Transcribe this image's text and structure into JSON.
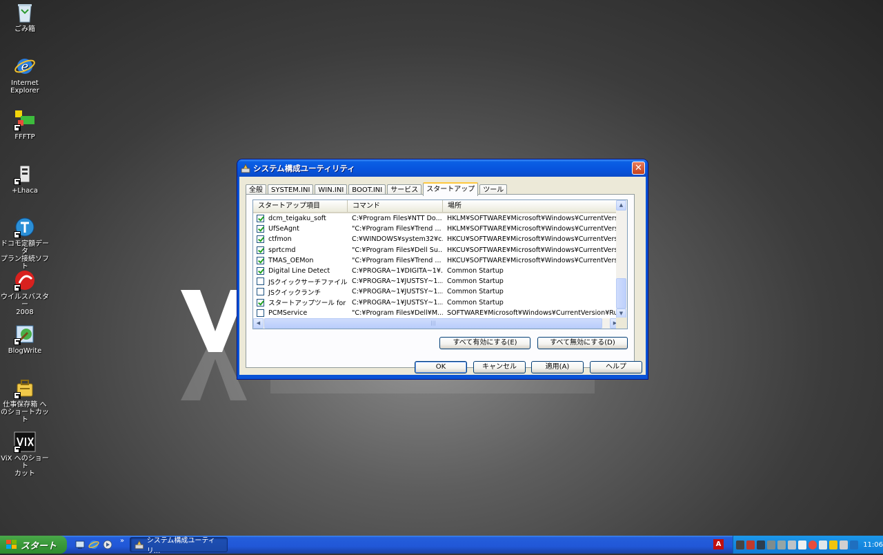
{
  "desktop": {
    "icons": [
      {
        "label": "ごみ箱"
      },
      {
        "label": "Internet\nExplorer"
      },
      {
        "label": "FFFTP"
      },
      {
        "label": "+Lhaca"
      },
      {
        "label": "ドコモ定額データ\nプラン接続ソフト"
      },
      {
        "label": "ウイルスバスター\n2008"
      },
      {
        "label": "BlogWrite"
      },
      {
        "label": "仕事保存箱 へ\nのショートカット"
      },
      {
        "label": "ViX へのショート\nカット"
      }
    ]
  },
  "window": {
    "title": "システム構成ユーティリティ",
    "close_label": "✕",
    "tabs": [
      "全般",
      "SYSTEM.INI",
      "WIN.INI",
      "BOOT.INI",
      "サービス",
      "スタートアップ",
      "ツール"
    ],
    "active_tab": "スタートアップ",
    "columns": [
      "スタートアップ項目",
      "コマンド",
      "場所"
    ],
    "rows": [
      {
        "checked": true,
        "item": "dcm_teigaku_soft",
        "command": "C:¥Program Files¥NTT Do...",
        "location": "HKLM¥SOFTWARE¥Microsoft¥Windows¥CurrentVersion¥"
      },
      {
        "checked": true,
        "item": "UfSeAgnt",
        "command": "\"C:¥Program Files¥Trend ...",
        "location": "HKLM¥SOFTWARE¥Microsoft¥Windows¥CurrentVersion¥"
      },
      {
        "checked": true,
        "item": "ctfmon",
        "command": "C:¥WINDOWS¥system32¥c...",
        "location": "HKCU¥SOFTWARE¥Microsoft¥Windows¥CurrentVersion."
      },
      {
        "checked": true,
        "item": "sprtcmd",
        "command": "\"C:¥Program Files¥Dell Su...",
        "location": "HKCU¥SOFTWARE¥Microsoft¥Windows¥CurrentVersion."
      },
      {
        "checked": true,
        "item": "TMAS_OEMon",
        "command": "\"C:¥Program Files¥Trend ...",
        "location": "HKCU¥SOFTWARE¥Microsoft¥Windows¥CurrentVersion."
      },
      {
        "checked": true,
        "item": "Digital Line Detect",
        "command": "C:¥PROGRA~1¥DIGITA~1¥...",
        "location": "Common Startup"
      },
      {
        "checked": false,
        "item": "JSクイックサーチファイル 自動...",
        "command": "C:¥PROGRA~1¥JUSTSY~1...",
        "location": "Common Startup"
      },
      {
        "checked": false,
        "item": "JSクイックランチ",
        "command": "C:¥PROGRA~1¥JUSTSY~1...",
        "location": "Common Startup"
      },
      {
        "checked": true,
        "item": "スタートアップツール for A...",
        "command": "C:¥PROGRA~1¥JUSTSY~1...",
        "location": "Common Startup"
      },
      {
        "checked": false,
        "item": "PCMService",
        "command": "\"C:¥Program Files¥Dell¥M...",
        "location": "SOFTWARE¥Microsoft¥Windows¥CurrentVersion¥Run"
      }
    ],
    "enable_all": "すべて有効にする(E)",
    "disable_all": "すべて無効にする(D)",
    "ok": "OK",
    "cancel": "キャンセル",
    "apply": "適用(A)",
    "help": "ヘルプ"
  },
  "taskbar": {
    "start_label": "スタート",
    "chevron": "»",
    "task_label": "システム構成ユーティリ...",
    "adobe_glyph": "A",
    "clock": "11:06"
  },
  "colors": {
    "xp_blue": "#0a53d6",
    "start_green": "#3c9b3c",
    "dialog_face": "#ece9d8"
  }
}
